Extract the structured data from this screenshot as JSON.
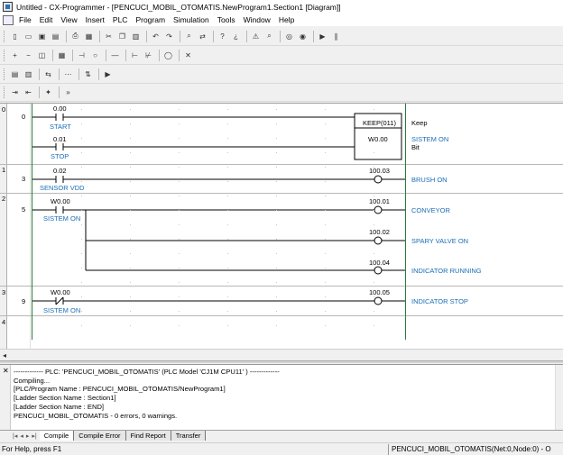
{
  "window": {
    "title": "Untitled - CX-Programmer - [PENCUCI_MOBIL_OTOMATIS.NewProgram1.Section1 [Diagram]]"
  },
  "menu": [
    "File",
    "Edit",
    "View",
    "Insert",
    "PLC",
    "Program",
    "Simulation",
    "Tools",
    "Window",
    "Help"
  ],
  "toolbar_rows": [
    [
      "new-icon",
      "open-icon",
      "save-icon",
      "save-all-icon",
      "|",
      "print-icon",
      "print-preview-icon",
      "|",
      "cut-icon",
      "copy-icon",
      "paste-icon",
      "|",
      "undo-icon",
      "redo-icon",
      "|",
      "find-icon",
      "replace-icon",
      "|",
      "help-icon",
      "context-help-icon",
      "|",
      "warning-icon",
      "search-icon",
      "|",
      "online-icon",
      "monitor-icon",
      "|",
      "run-icon",
      "pause-icon"
    ],
    [
      "zoom-in-icon",
      "zoom-out-icon",
      "zoom-fit-icon",
      "|",
      "grid-icon",
      "|",
      "contact-icon",
      "coil-icon",
      "|",
      "line-icon",
      "|",
      "no-contact-icon",
      "nc-contact-icon",
      "|",
      "coil-out-icon",
      "|",
      "delete-icon"
    ],
    [
      "layout-icon",
      "symbols-icon",
      "|",
      "connect-icon",
      "|",
      "step-icon",
      "|",
      "transfer-icon",
      "|",
      "debug-icon"
    ],
    [
      "indent-icon",
      "outdent-icon",
      "|",
      "bookmark-icon",
      "|",
      "next-icon"
    ]
  ],
  "rungs": [
    {
      "rung": "0",
      "step": "0"
    },
    {
      "rung": "1",
      "step": "3"
    },
    {
      "rung": "2",
      "step": "5"
    },
    {
      "rung": "3",
      "step": "9"
    },
    {
      "rung": "4",
      "step": ""
    }
  ],
  "ladder": {
    "r0_c1_addr": "0.00",
    "r0_c1_sym": "START",
    "r0_c2_addr": "0.01",
    "r0_c2_sym": "STOP",
    "keep_box_title": "KEEP(011)",
    "keep_box_operand": "W0.00",
    "keep_label": "Keep",
    "keep_sym": "SISTEM ON",
    "keep_type": "Bit",
    "r1_c_addr": "0.02",
    "r1_c_sym": "SENSOR VDD",
    "r1_out_addr": "100.03",
    "r1_out_sym": "BRUSH ON",
    "r2_c_addr": "W0.00",
    "r2_c_sym": "SISTEM ON",
    "r2_o1_addr": "100.01",
    "r2_o1_sym": "CONVEYOR",
    "r2_o2_addr": "100.02",
    "r2_o2_sym": "SPARY VALVE ON",
    "r2_o3_addr": "100.04",
    "r2_o3_sym": "INDICATOR RUNNING",
    "r3_c_addr": "W0.00",
    "r3_c_sym": "SISTEM ON",
    "r3_out_addr": "100.05",
    "r3_out_sym": "INDICATOR STOP"
  },
  "output": {
    "lines": [
      "------------- PLC: 'PENCUCI_MOBIL_OTOMATIS' (PLC Model 'CJ1M CPU11' ) -------------",
      "Compiling...",
      "[PLC/Program Name : PENCUCI_MOBIL_OTOMATIS/NewProgram1]",
      "[Ladder Section Name : Section1]",
      "[Ladder Section Name : END]",
      "",
      "PENCUCI_MOBIL_OTOMATIS - 0 errors, 0 warnings."
    ],
    "tabs": [
      "Compile",
      "Compile Error",
      "Find Report",
      "Transfer"
    ],
    "active_tab": "Compile"
  },
  "status": {
    "help": "For Help, press F1",
    "connection": "PENCUCI_MOBIL_OTOMATIS(Net:0,Node:0) - O"
  }
}
